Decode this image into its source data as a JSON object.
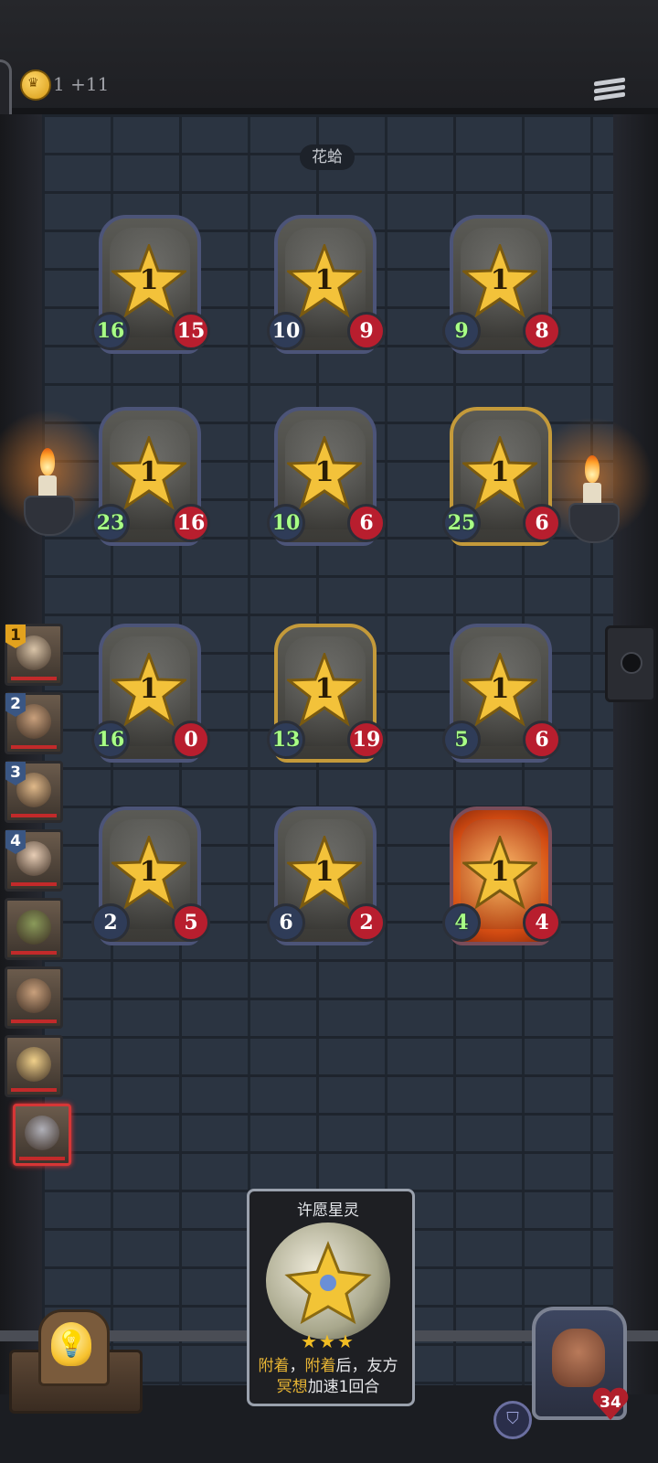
{
  "top": {
    "gold_text": "1 +11",
    "coin_icon": "crown-coin-icon"
  },
  "zone": {
    "name": "花蛤"
  },
  "cards": [
    {
      "id": "c1",
      "level": "1",
      "attack": "16",
      "attack_color": "green",
      "health": "15",
      "frame": "normal"
    },
    {
      "id": "c2",
      "level": "1",
      "attack": "10",
      "attack_color": "white",
      "health": "9",
      "frame": "normal"
    },
    {
      "id": "c3",
      "level": "1",
      "attack": "9",
      "attack_color": "green",
      "health": "8",
      "frame": "normal"
    },
    {
      "id": "c4",
      "level": "1",
      "attack": "23",
      "attack_color": "green",
      "health": "16",
      "frame": "normal"
    },
    {
      "id": "c5",
      "level": "1",
      "attack": "10",
      "attack_color": "green",
      "health": "6",
      "frame": "normal"
    },
    {
      "id": "c6",
      "level": "1",
      "attack": "25",
      "attack_color": "green",
      "health": "6",
      "frame": "gold"
    },
    {
      "id": "c7",
      "level": "1",
      "attack": "16",
      "attack_color": "green",
      "health": "0",
      "frame": "normal"
    },
    {
      "id": "c8",
      "level": "1",
      "attack": "13",
      "attack_color": "green",
      "health": "19",
      "frame": "gold"
    },
    {
      "id": "c9",
      "level": "1",
      "attack": "5",
      "attack_color": "green",
      "health": "6",
      "frame": "normal"
    },
    {
      "id": "c10",
      "level": "1",
      "attack": "2",
      "attack_color": "white",
      "health": "5",
      "frame": "normal"
    },
    {
      "id": "c11",
      "level": "1",
      "attack": "6",
      "attack_color": "white",
      "health": "2",
      "frame": "normal"
    },
    {
      "id": "c12",
      "level": "1",
      "attack": "4",
      "attack_color": "green",
      "health": "4",
      "frame": "fire"
    }
  ],
  "roster": [
    {
      "rank": "1"
    },
    {
      "rank": "2"
    },
    {
      "rank": "3"
    },
    {
      "rank": "4"
    },
    {
      "rank": ""
    },
    {
      "rank": ""
    },
    {
      "rank": ""
    },
    {
      "rank": "",
      "active": true
    }
  ],
  "skill_card": {
    "title": "许愿星灵",
    "stars": "★★★",
    "desc_kw1": "附着",
    "desc_sep1": "，",
    "desc_kw2": "附着",
    "desc_mid": "后，友方",
    "desc_kw3": "冥想",
    "desc_end": "加速1回合"
  },
  "hero": {
    "health": "34"
  },
  "icons": {
    "menu": "hamburger-menu-icon",
    "hint": "lightbulb-icon",
    "shield": "shield-icon"
  },
  "colors": {
    "wall": "#2b3441",
    "attack_green": "#a8ff86",
    "health_red": "#b81e2e",
    "gold_frame": "#c49a3a",
    "keyword_gold": "#e8b534"
  }
}
